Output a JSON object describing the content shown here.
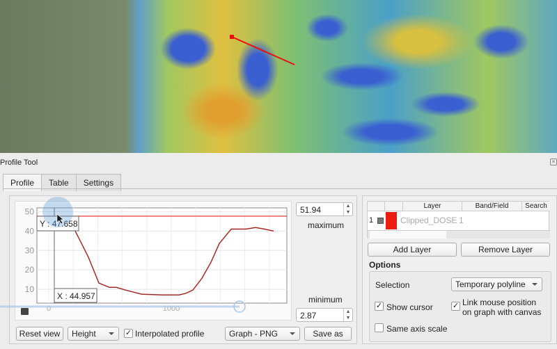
{
  "window": {
    "title": "Profile Tool"
  },
  "tabs": [
    {
      "label": "Profile",
      "active": true
    },
    {
      "label": "Table"
    },
    {
      "label": "Settings"
    }
  ],
  "graph": {
    "cursor_y_label": "Y : 47.658",
    "cursor_x_label": "X : 44.957",
    "cursor": {
      "x": 44.957,
      "y": 47.658
    },
    "y_ticks": [
      "50",
      "40",
      "30",
      "20",
      "10"
    ],
    "x_ticks": [
      "0",
      "1000"
    ],
    "y_range": [
      2.87,
      51.94
    ],
    "x_range": [
      -97,
      1943
    ],
    "line_color": "#e8231c",
    "profile": [
      [
        74,
        47.9
      ],
      [
        210,
        40.7
      ],
      [
        267,
        33.6
      ],
      [
        324,
        26.4
      ],
      [
        409,
        13.2
      ],
      [
        494,
        11
      ],
      [
        551,
        11
      ],
      [
        625,
        9.6
      ],
      [
        756,
        7.5
      ],
      [
        926,
        7.1
      ],
      [
        1062,
        7.1
      ],
      [
        1119,
        7.9
      ],
      [
        1176,
        9.6
      ],
      [
        1250,
        15.7
      ],
      [
        1324,
        24
      ],
      [
        1392,
        33.6
      ],
      [
        1489,
        41
      ],
      [
        1608,
        41
      ],
      [
        1688,
        41.8
      ],
      [
        1761,
        41
      ],
      [
        1835,
        40
      ]
    ]
  },
  "maximum": {
    "value": "51.94",
    "label": "maximum"
  },
  "minimum": {
    "value": "2.87",
    "label": "minimum"
  },
  "toolbar": {
    "reset": "Reset view",
    "mode": "Height",
    "interpolated": "Interpolated profile",
    "interpolated_checked": true,
    "export": "Graph - PNG",
    "save": "Save as"
  },
  "layers": {
    "headers": [
      "Layer",
      "Band/Field",
      "Search"
    ],
    "rows": [
      {
        "index": "1",
        "color": "#ee1c10",
        "layer": "Clipped_DOSE",
        "band": "1",
        "search": ""
      }
    ]
  },
  "buttons": {
    "add": "Add Layer",
    "remove": "Remove Layer"
  },
  "options": {
    "title": "Options",
    "selection_label": "Selection",
    "selection_value": "Temporary polyline",
    "show_cursor": "Show cursor",
    "show_cursor_checked": true,
    "link_mouse": "Link mouse position",
    "link_mouse2": "on graph with canvas",
    "link_checked": true,
    "same_axis": "Same axis scale",
    "same_axis_checked": false
  }
}
